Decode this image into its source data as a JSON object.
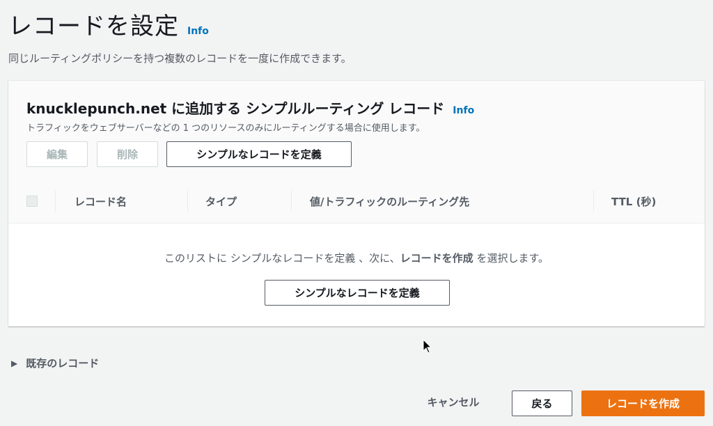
{
  "page": {
    "title": "レコードを設定",
    "info": "Info",
    "description": "同じルーティングポリシーを持つ複数のレコードを一度に作成できます。"
  },
  "panel": {
    "title": "knucklepunch.net に追加する シンプルルーティング レコード",
    "info": "Info",
    "subtitle": "トラフィックをウェブサーバーなどの 1 つのリソースのみにルーティングする場合に使用します。",
    "buttons": {
      "edit": "編集",
      "delete": "削除",
      "define": "シンプルなレコードを定義"
    },
    "table": {
      "columns": [
        "レコード名",
        "タイプ",
        "値/トラフィックのルーティング先",
        "TTL (秒)"
      ]
    },
    "empty": {
      "prefix": "このリストに シンプルなレコードを定義 、次に、",
      "bold": "レコードを作成",
      "suffix": " を選択します。",
      "button": "シンプルなレコードを定義"
    }
  },
  "existing_records": {
    "label": "既存のレコード",
    "caret_icon": "caret-right-icon"
  },
  "footer": {
    "cancel": "キャンセル",
    "back": "戻る",
    "create": "レコードを作成"
  },
  "colors": {
    "accent": "#ec7211",
    "link": "#0073bb",
    "background": "#f2f3f3"
  }
}
